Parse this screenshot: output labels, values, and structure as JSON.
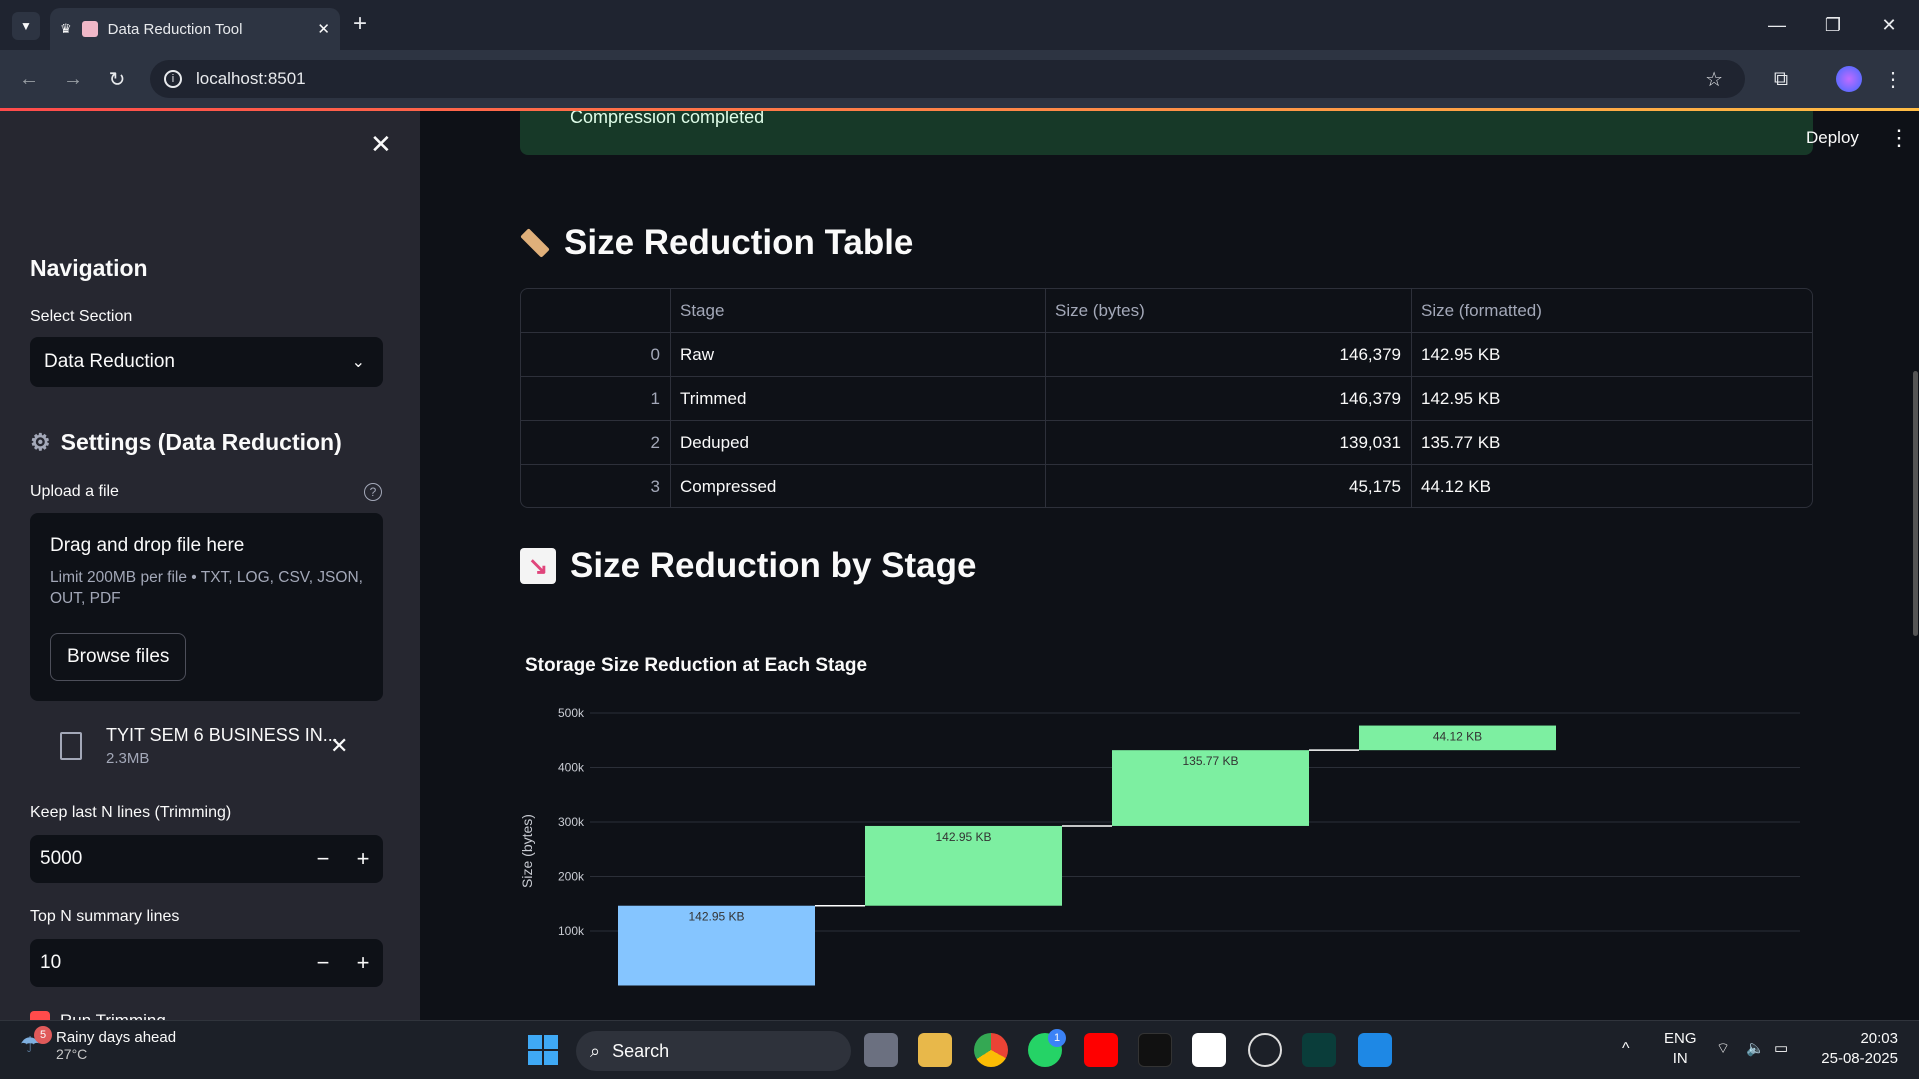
{
  "browser": {
    "tab_title": "Data Reduction Tool",
    "url": "localhost:8501"
  },
  "sidebar": {
    "nav_heading": "Navigation",
    "select_label": "Select Section",
    "select_value": "Data Reduction",
    "settings_heading": "Settings (Data Reduction)",
    "upload_label": "Upload a file",
    "drop_title": "Drag and drop file here",
    "drop_subtitle": "Limit 200MB per file • TXT, LOG, CSV, JSON, OUT, PDF",
    "browse_label": "Browse files",
    "file_name": "TYIT SEM 6 BUSINESS IN...",
    "file_size": "2.3MB",
    "trim_label": "Keep last N lines (Trimming)",
    "trim_value": "5000",
    "topn_label": "Top N summary lines",
    "topn_value": "10",
    "dedupe_label": "Run Trimming"
  },
  "header": {
    "deploy": "Deploy"
  },
  "main": {
    "success_text": "Compression completed",
    "table_heading": "Size Reduction Table",
    "table": {
      "columns": [
        "",
        "Stage",
        "Size (bytes)",
        "Size (formatted)"
      ],
      "rows": [
        [
          "0",
          "Raw",
          "146,379",
          "142.95 KB"
        ],
        [
          "1",
          "Trimmed",
          "146,379",
          "142.95 KB"
        ],
        [
          "2",
          "Deduped",
          "139,031",
          "135.77 KB"
        ],
        [
          "3",
          "Compressed",
          "45,175",
          "44.12 KB"
        ]
      ]
    },
    "chart_heading": "Size Reduction by Stage"
  },
  "chart_data": {
    "type": "waterfall",
    "title": "Storage Size Reduction at Each Stage",
    "ylabel": "Size (bytes)",
    "ylim": [
      100000,
      520000
    ],
    "yticks": [
      {
        "v": 100000,
        "t": "100k"
      },
      {
        "v": 200000,
        "t": "200k"
      },
      {
        "v": 300000,
        "t": "300k"
      },
      {
        "v": 400000,
        "t": "400k"
      },
      {
        "v": 500000,
        "t": "500k"
      }
    ],
    "bars": [
      {
        "base": 0,
        "top": 146379,
        "label": "142.95 KB",
        "color": "#85c5ff"
      },
      {
        "base": 146379,
        "top": 292758,
        "label": "142.95 KB",
        "color": "#7defa1"
      },
      {
        "base": 292758,
        "top": 431789,
        "label": "135.77 KB",
        "color": "#7defa1"
      },
      {
        "base": 431789,
        "top": 476964,
        "label": "44.12 KB",
        "color": "#7defa1"
      }
    ]
  },
  "taskbar": {
    "weather_title": "Rainy days ahead",
    "weather_temp": "27°C",
    "weather_badge": "5",
    "search": "Search",
    "lang1": "ENG",
    "lang2": "IN",
    "time": "20:03",
    "date": "25-08-2025",
    "whatsapp_badge": "1"
  }
}
